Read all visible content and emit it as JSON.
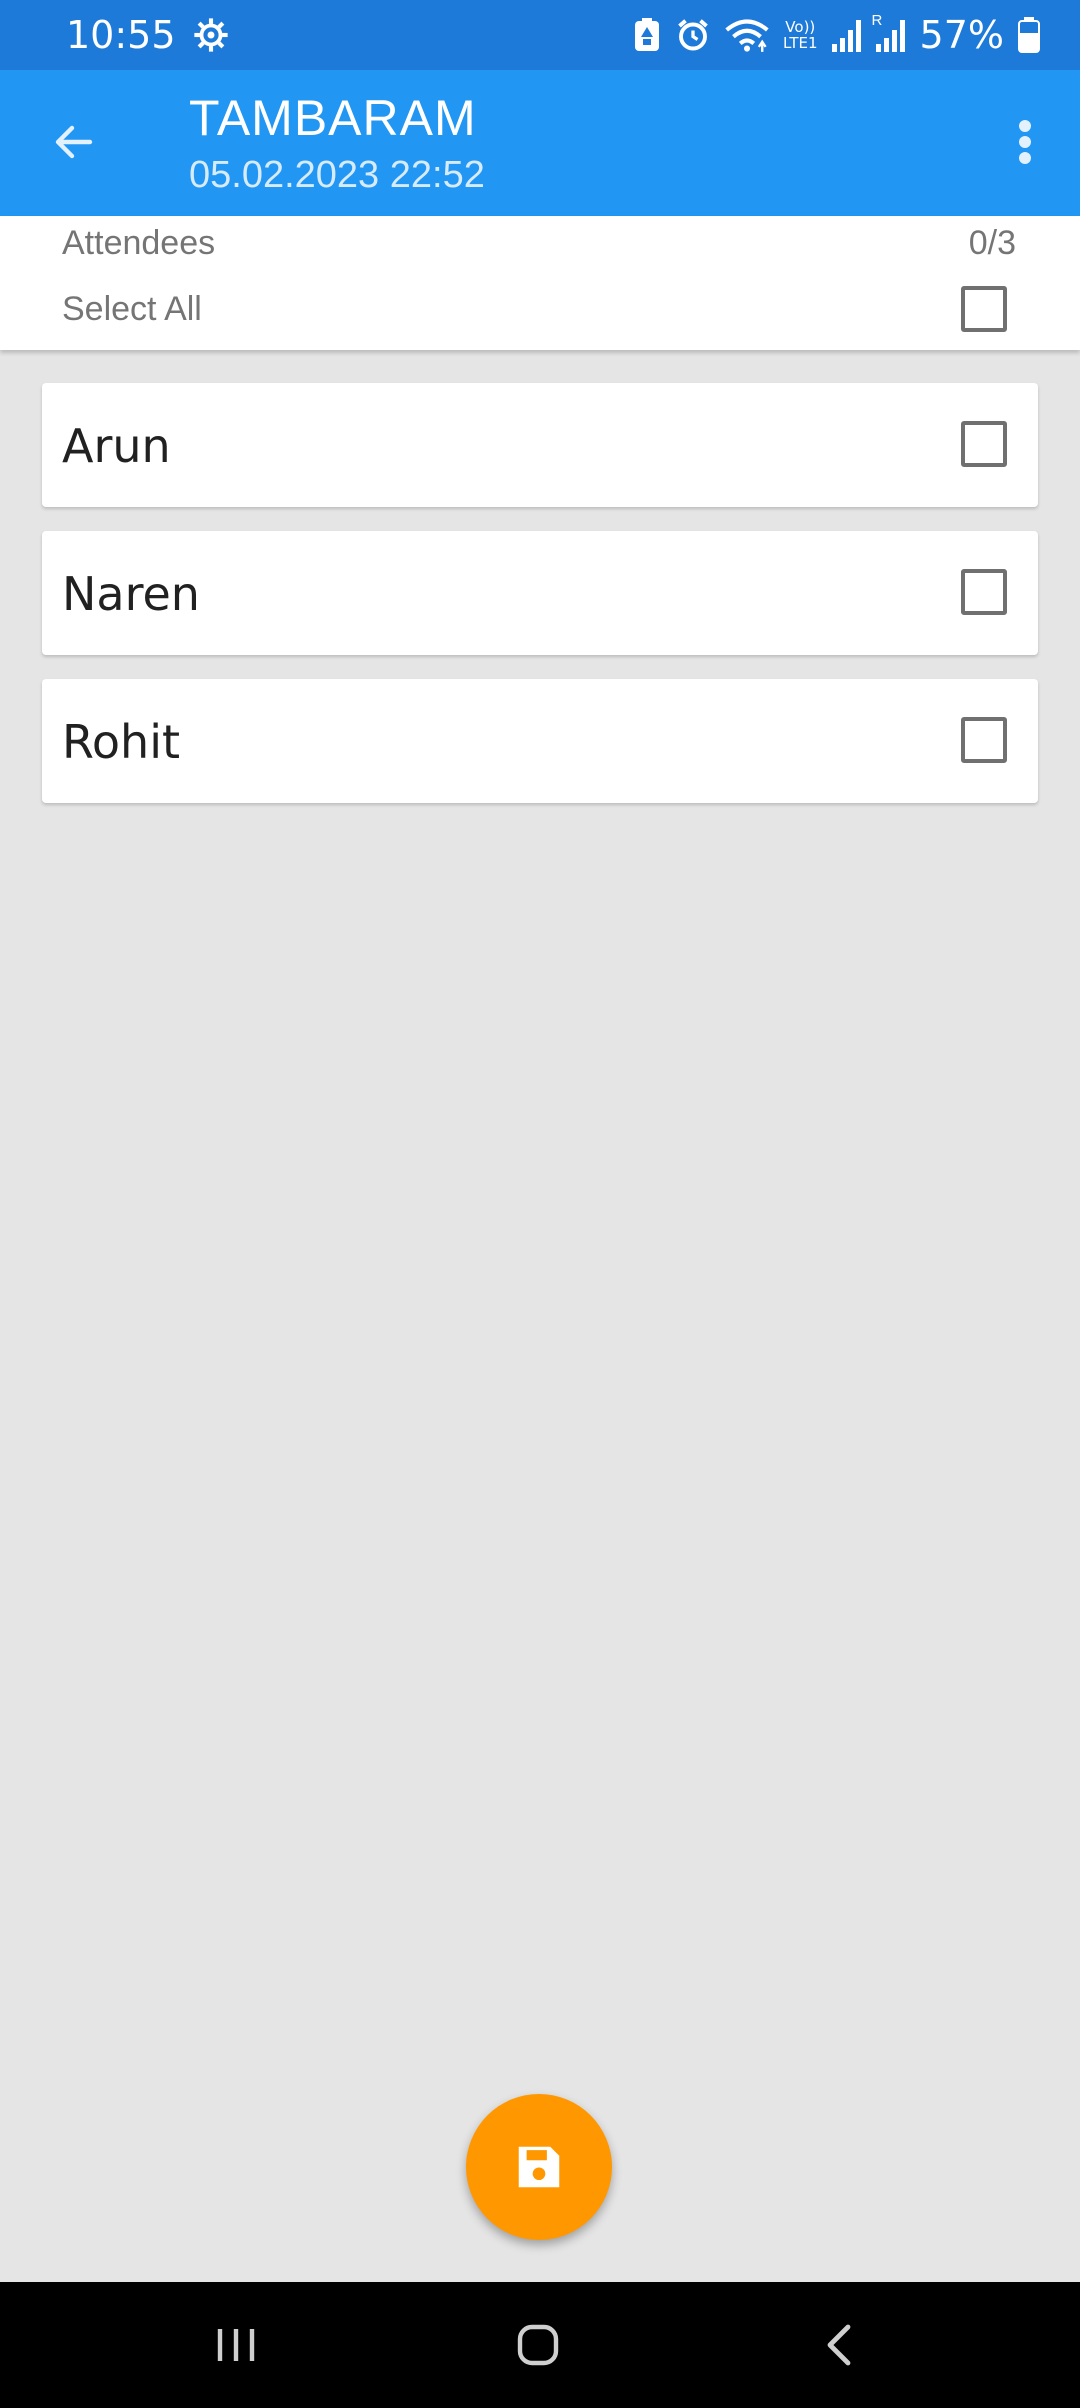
{
  "status_bar": {
    "time": "10:55",
    "battery": "57%",
    "icons": [
      "settings-gear-icon",
      "battery-saver-icon",
      "alarm-icon",
      "wifi-icon",
      "volte-lte-icon",
      "signal-icon",
      "roaming-signal-icon",
      "battery-icon"
    ],
    "network_label_top": "Vo))",
    "network_label_bottom": "LTE1",
    "roaming_label": "R"
  },
  "app_bar": {
    "title": "TAMBARAM",
    "subtitle": "05.02.2023 22:52",
    "back_icon": "arrow-left-icon",
    "more_icon": "more-vertical-icon",
    "color": "#2196f3",
    "status_color": "#1e7ad9"
  },
  "header": {
    "attendees_label": "Attendees",
    "attendees_count": "0/3",
    "select_all_label": "Select All",
    "select_all_checked": false
  },
  "attendees": [
    {
      "name": "Arun",
      "checked": false
    },
    {
      "name": "Naren",
      "checked": false
    },
    {
      "name": "Rohit",
      "checked": false
    }
  ],
  "fab": {
    "icon": "save-icon",
    "color": "#ff9800"
  },
  "nav_bar": {
    "recent_icon": "recent-apps-icon",
    "home_icon": "home-icon",
    "back_icon": "nav-back-icon"
  }
}
